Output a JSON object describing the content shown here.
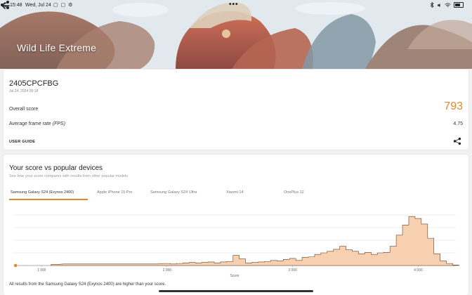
{
  "status_bar": {
    "time": "15:48",
    "date": "Wed, Jul 24",
    "app_icons": "▢ ▢ ⚙",
    "center_dots": "•••"
  },
  "header": {
    "title": "Wild Life Extreme"
  },
  "result": {
    "device": "2405CPCFBG",
    "date": "Jul 24, 2024 09:18",
    "overall_score_label": "Overall score",
    "overall_score_value": "793",
    "fps_label_main": "Average frame rate ",
    "fps_label_unit": "(FPS)",
    "fps_value": "4.75",
    "user_guide_label": "USER GUIDE"
  },
  "compare": {
    "title": "Your score vs popular devices",
    "subtitle": "See how your score compares with results from other popular models",
    "tabs": [
      {
        "label": "Samsung Galaxy S24 (Exynos 2400)"
      },
      {
        "label": "Apple iPhone 15 Pro"
      },
      {
        "label": "Samsung Galaxy S24 Ultra"
      },
      {
        "label": "Xiaomi 14"
      },
      {
        "label": "OnePlus 12"
      }
    ],
    "footer_note": "All results from the Samsung Galaxy S24 (Exynos 2400) are higher than your score."
  },
  "colors": {
    "accent": "#e08a2c",
    "histogram_fill": "#f7d0b2",
    "histogram_stroke": "#6b3f1f"
  },
  "chart_data": {
    "type": "area",
    "xlabel": "Score",
    "ylabel": "",
    "x_ticks": [
      "1 000",
      "2 000",
      "3 000",
      "4 000"
    ],
    "your_score": 793,
    "xlim": [
      775,
      4300
    ],
    "ylim": [
      0,
      100
    ],
    "grid": true,
    "bins": [
      [
        1100,
        2
      ],
      [
        1200,
        3
      ],
      [
        1300,
        3
      ],
      [
        1400,
        3
      ],
      [
        1500,
        3
      ],
      [
        1600,
        3
      ],
      [
        1700,
        3
      ],
      [
        1800,
        3
      ],
      [
        1900,
        3
      ],
      [
        2000,
        4
      ],
      [
        2050,
        3
      ],
      [
        2100,
        4
      ],
      [
        2150,
        5
      ],
      [
        2200,
        6
      ],
      [
        2250,
        5
      ],
      [
        2300,
        6
      ],
      [
        2350,
        7
      ],
      [
        2400,
        5
      ],
      [
        2450,
        7
      ],
      [
        2500,
        8
      ],
      [
        2550,
        20
      ],
      [
        2600,
        13
      ],
      [
        2650,
        5
      ],
      [
        2700,
        6
      ],
      [
        2750,
        7
      ],
      [
        2800,
        8
      ],
      [
        2850,
        10
      ],
      [
        2900,
        9
      ],
      [
        2950,
        12
      ],
      [
        3000,
        14
      ],
      [
        3050,
        10
      ],
      [
        3100,
        16
      ],
      [
        3150,
        17
      ],
      [
        3200,
        22
      ],
      [
        3250,
        25
      ],
      [
        3300,
        28
      ],
      [
        3350,
        32
      ],
      [
        3400,
        38
      ],
      [
        3450,
        31
      ],
      [
        3500,
        28
      ],
      [
        3550,
        23
      ],
      [
        3600,
        26
      ],
      [
        3650,
        22
      ],
      [
        3700,
        25
      ],
      [
        3750,
        26
      ],
      [
        3800,
        38
      ],
      [
        3850,
        60
      ],
      [
        3900,
        80
      ],
      [
        3950,
        97
      ],
      [
        4000,
        93
      ],
      [
        4050,
        82
      ],
      [
        4100,
        54
      ],
      [
        4150,
        23
      ],
      [
        4200,
        9
      ],
      [
        4250,
        4
      ],
      [
        4300,
        1
      ]
    ]
  }
}
